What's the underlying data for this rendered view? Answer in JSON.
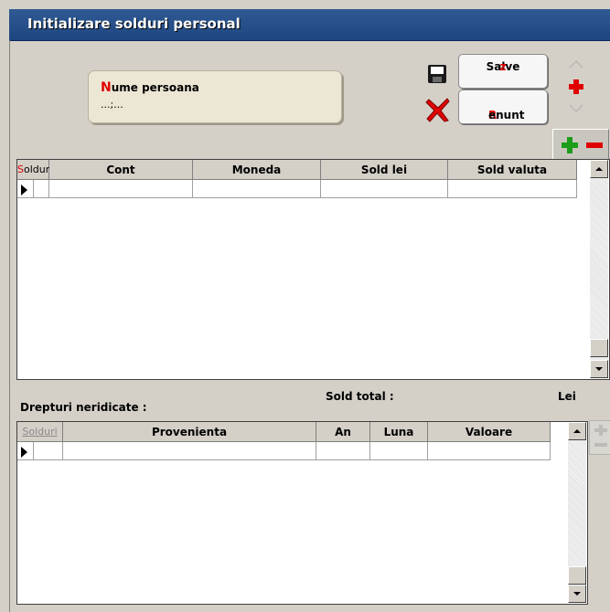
{
  "window": {
    "title": "Initializare solduri personal"
  },
  "person": {
    "label_hot": "N",
    "label_rest": "ume persoana",
    "value": "...;..."
  },
  "buttons": {
    "save_main": "Salve",
    "save_hot": "z",
    "cancel_hot": "R",
    "cancel_rest": "enunt"
  },
  "icons": {
    "save": "floppy-disk-icon",
    "cancel": "red-x-icon",
    "nav": [
      "arrow-up-icon",
      "red-plus-icon",
      "arrow-down-icon"
    ],
    "row_ops": [
      "green-plus-icon",
      "red-minus-icon"
    ]
  },
  "solduri_table": {
    "headers": [
      "Solduri",
      "Cont",
      "Moneda",
      "Sold lei",
      "Sold valuta"
    ],
    "headers_hot_first": "S",
    "headers_rest_first": "olduri"
  },
  "totals": {
    "sold_total_label": "Sold total :",
    "currency": "Lei"
  },
  "drepturi": {
    "title": "Drepturi neridicate :",
    "headers": [
      "Solduri",
      "Provenienta",
      "An",
      "Luna",
      "Valoare"
    ]
  },
  "colors": {
    "titlebar": "#2b5390",
    "panel": "#d4d0c8",
    "info_box": "#ece6d4",
    "hotkey": "#e00000"
  }
}
